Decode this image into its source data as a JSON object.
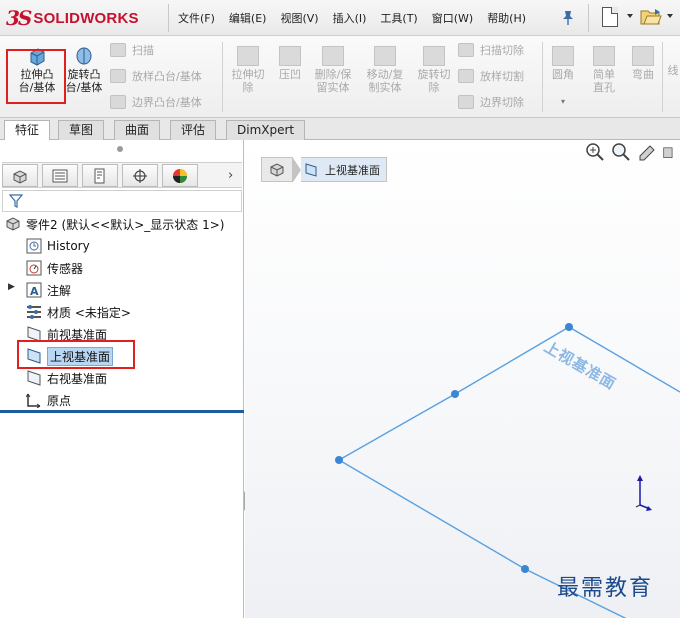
{
  "app": {
    "brand_prefix": "3S",
    "brand_name": "SOLIDWORKS"
  },
  "menubar": {
    "items": [
      "文件(F)",
      "编辑(E)",
      "视图(V)",
      "插入(I)",
      "工具(T)",
      "窗口(W)",
      "帮助(H)"
    ]
  },
  "commands": {
    "extrude_boss": "拉伸凸台/基体",
    "revolve_boss": "旋转凸台/基体",
    "sweep": "扫描",
    "loft": "放样凸台/基体",
    "boundary_boss": "边界凸台/基体",
    "extrude_cut": "拉伸切除",
    "hole_wizard": "压凹",
    "delete_body": "删除/保留实体",
    "move_copy": "移动/复制实体",
    "revolve_cut": "旋转切除",
    "sweep_cut": "扫描切除",
    "loft_cut": "放样切割",
    "boundary_cut": "边界切除",
    "fillet": "圆角",
    "simple_hole": "简单直孔",
    "flex": "弯曲",
    "more": "线"
  },
  "tabs": [
    "特征",
    "草图",
    "曲面",
    "评估",
    "DimXpert"
  ],
  "active_tab": "特征",
  "tree": {
    "root": "零件2 (默认<<默认>_显示状态 1>)",
    "items": [
      {
        "label": "History",
        "icon": "history-icon"
      },
      {
        "label": "传感器",
        "icon": "sensor-icon"
      },
      {
        "label": "注解",
        "icon": "annotation-icon"
      },
      {
        "label": "材质 <未指定>",
        "icon": "material-icon"
      },
      {
        "label": "前视基准面",
        "icon": "plane-icon"
      },
      {
        "label": "上视基准面",
        "icon": "plane-icon",
        "selected": true
      },
      {
        "label": "右视基准面",
        "icon": "plane-icon"
      },
      {
        "label": "原点",
        "icon": "origin-icon"
      }
    ]
  },
  "breadcrumb": {
    "plane": "上视基准面"
  },
  "viewport": {
    "plane_label": "上视基准面"
  },
  "watermark": "最需教育",
  "colors": {
    "brand_red": "#c8102e",
    "highlight_red": "#e02020",
    "plane_blue": "#5aa0e0",
    "selection_blue": "#b9d6f2"
  }
}
